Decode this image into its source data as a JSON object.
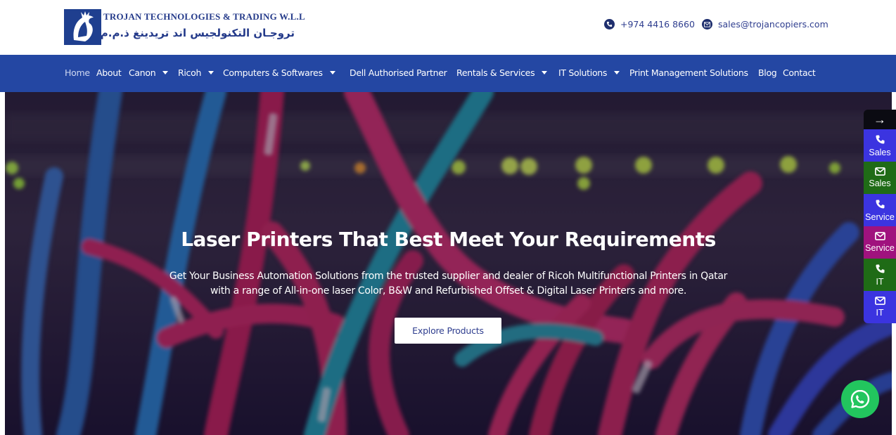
{
  "header": {
    "company_name": "TROJAN TECHNOLOGIES & TRADING W.L.L",
    "company_name_arabic": "تروجـان التكنولجيس اند تريدينغ ذ.م.م",
    "phone": "+974 4416 8660",
    "email": "sales@trojancopiers.com"
  },
  "nav": {
    "items": [
      {
        "label": "Home",
        "active": true
      },
      {
        "label": "About"
      },
      {
        "label": "Canon",
        "dropdown": true
      },
      {
        "label": "Ricoh",
        "dropdown": true
      },
      {
        "label": "Computers & Softwares",
        "dropdown": true
      },
      {
        "label": "Dell Authorised Partner"
      },
      {
        "label": "Rentals & Services",
        "dropdown": true
      },
      {
        "label": "IT Solutions",
        "dropdown": true
      },
      {
        "label": "Print Management Solutions"
      },
      {
        "label": "Blog"
      },
      {
        "label": "Contact"
      }
    ]
  },
  "hero": {
    "title": "Laser Printers That Best Meet Your Requirements",
    "subtitle_line1": "Get Your Business Automation Solutions from the trusted supplier and dealer of Ricoh Multifunctional Printers in Qatar",
    "subtitle_line2": "with a range of All-in-one laser Color, B&W and Refurbished Offset & Digital Laser Printers and more.",
    "button_label": "Explore Products"
  },
  "side_panel": {
    "toggle_icon": "arrow-right-icon",
    "buttons": [
      {
        "label": "Sales",
        "icon": "phone-icon",
        "color": "#3b34e0"
      },
      {
        "label": "Sales",
        "icon": "envelope-icon",
        "color": "#1f6b16"
      },
      {
        "label": "Service",
        "icon": "phone-icon",
        "color": "#3b34e0"
      },
      {
        "label": "Service",
        "icon": "envelope-icon",
        "color": "#a0127e"
      },
      {
        "label": "IT",
        "icon": "phone-icon",
        "color": "#1f6b16"
      },
      {
        "label": "IT",
        "icon": "envelope-icon",
        "color": "#3b34e0"
      }
    ]
  },
  "whatsapp": {
    "icon": "whatsapp-icon",
    "color": "#22c55e"
  },
  "colors": {
    "brand_blue": "#2447a3",
    "text_blue": "#2f3e8f"
  }
}
